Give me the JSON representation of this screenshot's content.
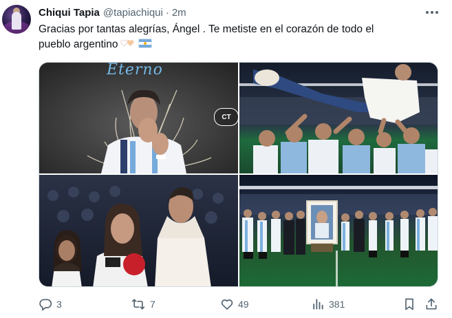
{
  "tweet": {
    "author_name": "Chiqui Tapia",
    "handle": "@tapiachiqui",
    "separator": "·",
    "time": "2m",
    "text_line1": "Gracias por tantas alegrías, Ángel . Te metiste en el corazón de todo el",
    "text_line2": "pueblo argentino"
  },
  "media": {
    "image1_overlay_text": "Eterno",
    "image1_badge": "CT"
  },
  "actions": {
    "replies": "3",
    "reposts": "7",
    "likes": "49",
    "views": "381"
  },
  "colors": {
    "text_primary": "#0f1419",
    "text_secondary": "#536471",
    "border": "#cfd9de",
    "argentina_blue": "#75aadb",
    "heart_white": "#f2f2f2",
    "heart_peach": "#f6c8a0"
  },
  "icons": [
    "reply-icon",
    "repost-icon",
    "like-icon",
    "views-icon",
    "bookmark-icon",
    "share-icon",
    "more-icon",
    "argentina-flag-icon",
    "hearts-emoji-icon"
  ]
}
